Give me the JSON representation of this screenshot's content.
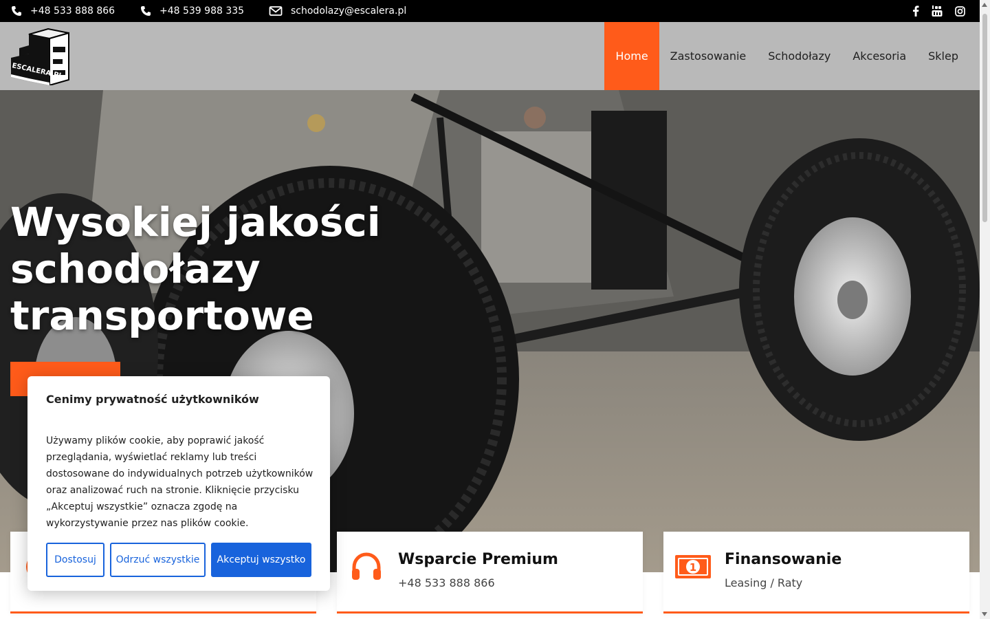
{
  "topbar": {
    "phone1": "+48 533 888 866",
    "phone2": "+48 539 988 335",
    "email": "schodolazy@escalera.pl",
    "social": [
      "facebook-icon",
      "youtube-icon",
      "instagram-icon"
    ]
  },
  "header": {
    "logo_text": "ESCALERA.PL",
    "nav": [
      {
        "label": "Home",
        "active": true
      },
      {
        "label": "Zastosowanie",
        "active": false
      },
      {
        "label": "Schodołazy",
        "active": false
      },
      {
        "label": "Akcesoria",
        "active": false
      },
      {
        "label": "Sklep",
        "active": false
      }
    ]
  },
  "hero": {
    "title": "Wysokiej jakości schodołazy transportowe"
  },
  "cards": [
    {
      "title": "",
      "subtitle": "",
      "icon": "brand-icon"
    },
    {
      "title": "Wsparcie Premium",
      "subtitle": "+48 533 888 866",
      "icon": "headphones-icon"
    },
    {
      "title": "Finansowanie",
      "subtitle": "Leasing / Raty",
      "icon": "money-icon"
    }
  ],
  "cookie": {
    "title": "Cenimy prywatność użytkowników",
    "text": "Używamy plików cookie, aby poprawić jakość przeglądania, wyświetlać reklamy lub treści dostosowane do indywidualnych potrzeb użytkowników oraz analizować ruch na stronie. Kliknięcie przycisku „Akceptuj wszystkie” oznacza zgodę na wykorzystywanie przez nas plików cookie.",
    "customize": "Dostosuj",
    "reject": "Odrzuć wszystkie",
    "accept": "Akceptuj wszystko"
  },
  "colors": {
    "accent": "#ff5b1a",
    "cookie_blue": "#1863dc",
    "topbar": "#000000",
    "header": "#b9b9b9"
  }
}
